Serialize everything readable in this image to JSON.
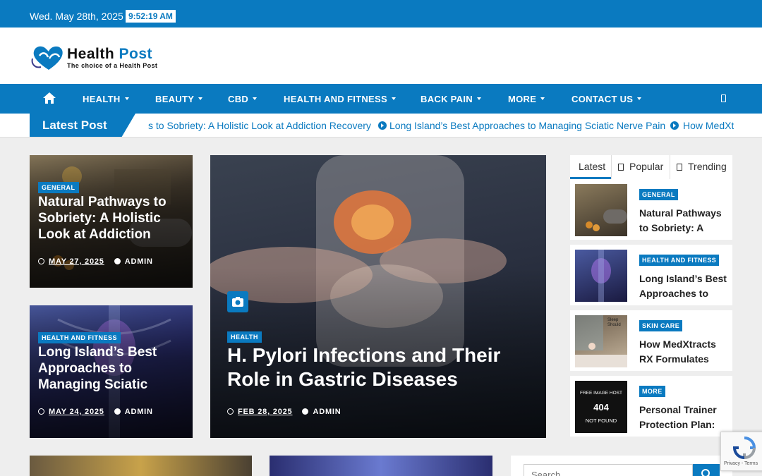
{
  "topbar": {
    "date": "Wed. May 28th, 2025",
    "time": "9:52:19 AM"
  },
  "logo": {
    "name_part1": "Health",
    "name_part2": "Post",
    "tagline": "The choice of a Health Post"
  },
  "nav": {
    "items": [
      {
        "label": "HEALTH"
      },
      {
        "label": "BEAUTY"
      },
      {
        "label": "CBD"
      },
      {
        "label": "HEALTH AND FITNESS"
      },
      {
        "label": "BACK PAIN"
      },
      {
        "label": "MORE"
      },
      {
        "label": "CONTACT US"
      }
    ]
  },
  "ticker": {
    "label": "Latest Post",
    "items": [
      "s to Sobriety: A Holistic Look at Addiction Recovery",
      "Long Island’s Best Approaches to Managing Sciatic Nerve Pain",
      "How MedXt"
    ]
  },
  "cards": [
    {
      "badge": "GENERAL",
      "title": "Natural Pathways to Sobriety: A Holistic Look at Addiction",
      "date": "MAY 27, 2025",
      "author": "ADMIN"
    },
    {
      "badge": "HEALTH AND FITNESS",
      "title": "Long Island’s Best Approaches to Managing Sciatic",
      "date": "MAY 24, 2025",
      "author": "ADMIN"
    },
    {
      "badge": "HEALTH",
      "title": "H. Pylori Infections and Their Role in Gastric Diseases",
      "date": "FEB 28, 2025",
      "author": "ADMIN"
    }
  ],
  "sidebar": {
    "tabs": [
      {
        "label": "Latest"
      },
      {
        "label": "Popular"
      },
      {
        "label": "Trending"
      }
    ],
    "items": [
      {
        "badge": "GENERAL",
        "title": "Natural Pathways to Sobriety: A"
      },
      {
        "badge": "HEALTH AND FITNESS",
        "title": "Long Island’s Best Approaches to"
      },
      {
        "badge": "SKIN CARE",
        "title": "How MedXtracts RX Formulates"
      },
      {
        "badge": "MORE",
        "title": "Personal Trainer Protection Plan:"
      }
    ],
    "placeholder_thumb": {
      "line1": "FREE IMAGE HOST",
      "line2": "404",
      "line3": "NOT FOUND"
    },
    "spa_text": {
      "line1": "Sleep",
      "line2": "Should"
    }
  },
  "search": {
    "placeholder": "Search"
  },
  "recaptcha": {
    "label": "Privacy - Terms"
  },
  "colors": {
    "brand": "#0a7ac0"
  }
}
